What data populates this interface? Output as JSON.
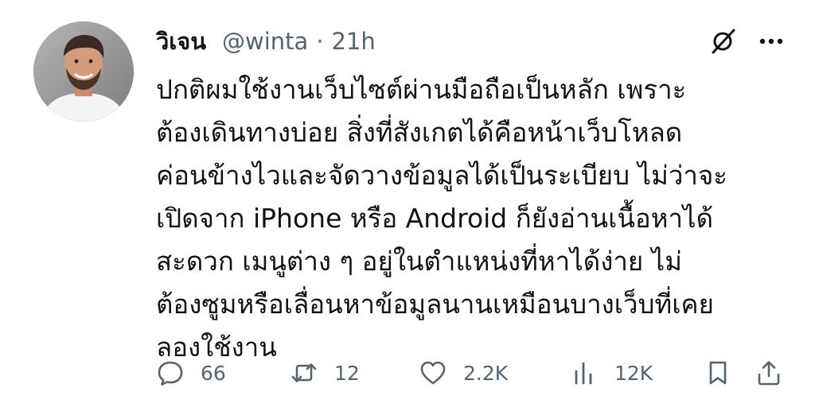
{
  "tweet": {
    "author_name": "วิเจน",
    "handle": "@winta",
    "separator": "·",
    "time": "21h",
    "body_lines": [
      "ปกติผมใช้งานเว็บไซต์ผ่านมือถือเป็นหลัก เพราะ",
      "ต้องเดินทางบ่อย สิ่งที่สังเกตได้คือหน้าเว็บโหลด",
      "ค่อนข้างไวและจัดวางข้อมูลได้เป็นระเบียบ ไม่ว่าจะ",
      "เปิดจาก iPhone หรือ Android ก็ยังอ่านเนื้อหาได้",
      "สะดวก เมนูต่าง ๆ อยู่ในตำแหน่งที่หาได้ง่าย ไม่",
      "ต้องซูมหรือเลื่อนหาข้อมูลนานเหมือนบางเว็บที่เคย",
      "ลองใช้งาน"
    ],
    "stats": {
      "replies": "66",
      "reposts": "12",
      "likes": "2.2K",
      "views": "12K"
    }
  },
  "icons": {
    "top_right": [
      "grok-icon",
      "more-options-icon"
    ],
    "actions": [
      "reply-icon",
      "repost-icon",
      "like-icon",
      "views-icon",
      "bookmark-icon",
      "share-icon"
    ]
  },
  "colors": {
    "text_primary": "#0f1419",
    "text_secondary": "#536471",
    "background": "#ffffff"
  }
}
